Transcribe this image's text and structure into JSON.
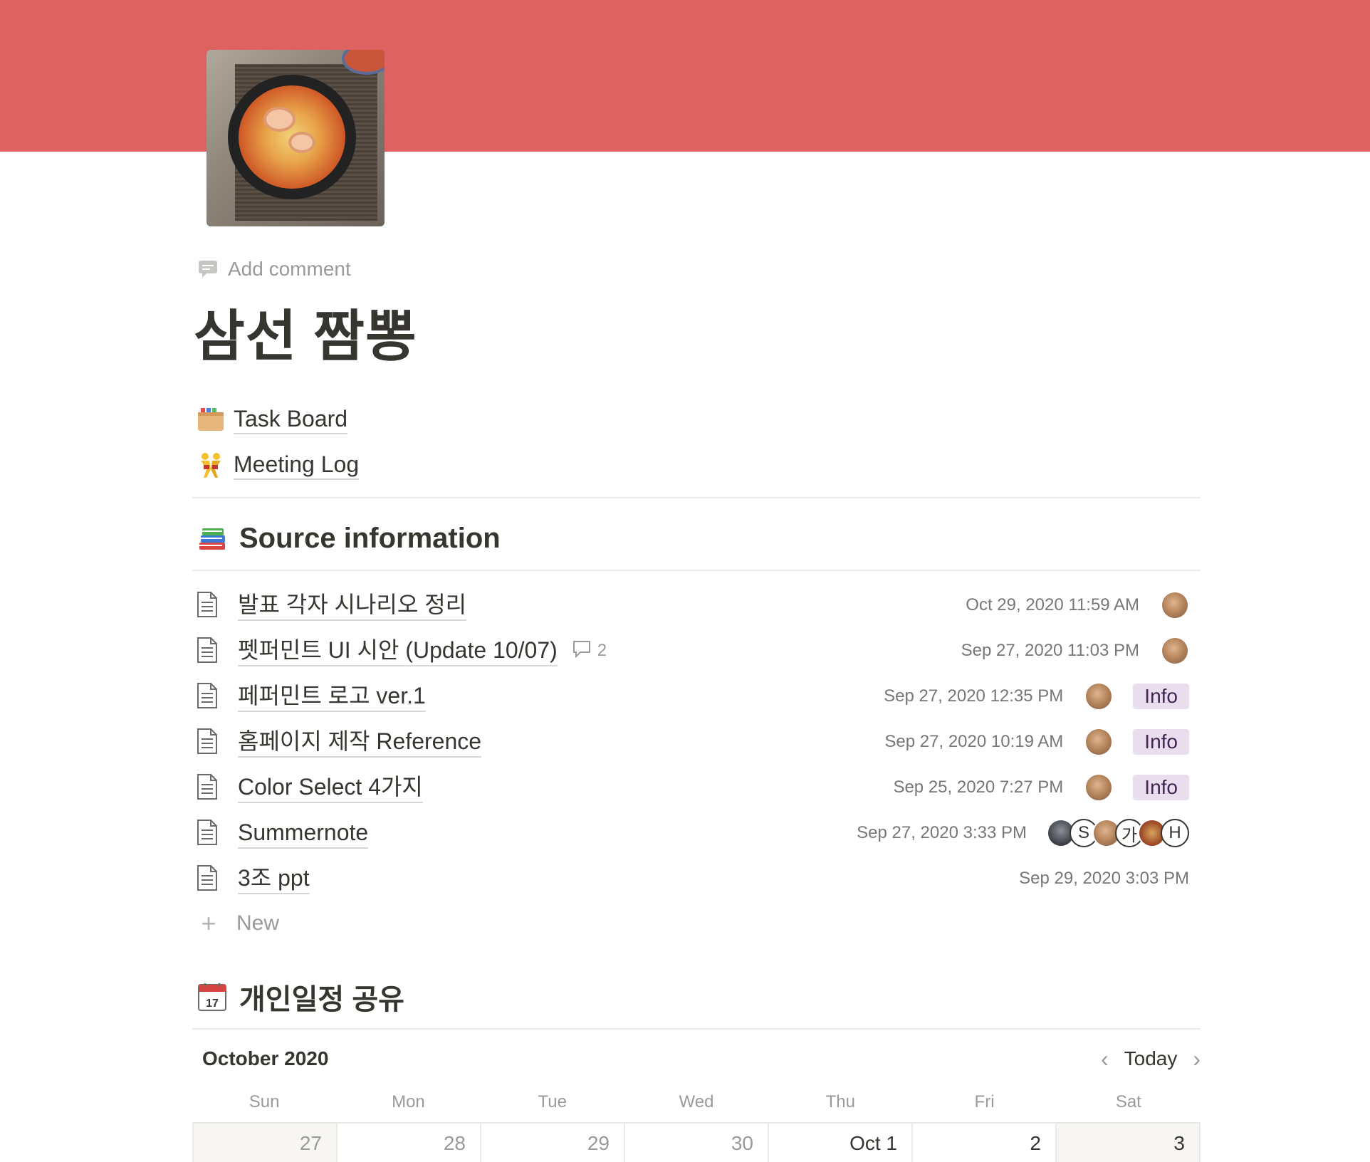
{
  "header": {
    "cover_color": "#de625f",
    "add_comment_label": "Add comment",
    "title": "삼선 짬뽕"
  },
  "links": [
    {
      "icon": "file-box-icon",
      "label": "Task Board"
    },
    {
      "icon": "wrestlers-icon",
      "label": "Meeting Log"
    }
  ],
  "source_section": {
    "icon": "books-icon",
    "heading": "Source  information",
    "rows": [
      {
        "title": "발표 각자 시나리오 정리",
        "date": "Oct 29, 2020 11:59 AM"
      },
      {
        "title": "펫퍼민트 UI 시안 (Update 10/07)",
        "comment_count": "2",
        "date": "Sep 27, 2020 11:03 PM"
      },
      {
        "title": "페퍼민트 로고 ver.1",
        "date": "Sep 27, 2020 12:35 PM",
        "tag": "Info"
      },
      {
        "title": "홈페이지 제작 Reference",
        "date": "Sep 27, 2020 10:19 AM",
        "tag": "Info"
      },
      {
        "title": "Color Select 4가지",
        "date": "Sep 25, 2020 7:27 PM",
        "tag": "Info"
      },
      {
        "title": "Summernote",
        "date": "Sep 27, 2020 3:33 PM",
        "avatar_letters": [
          "S",
          "가",
          "H"
        ]
      },
      {
        "title": "3조 ppt",
        "date": "Sep 29, 2020 3:03 PM"
      }
    ],
    "new_label": "New"
  },
  "calendar_section": {
    "icon": "calendar-icon",
    "heading": "개인일정 공유",
    "month_label": "October 2020",
    "today_label": "Today",
    "weekdays": [
      "Sun",
      "Mon",
      "Tue",
      "Wed",
      "Thu",
      "Fri",
      "Sat"
    ],
    "first_week": [
      "27",
      "28",
      "29",
      "30",
      "Oct 1",
      "2",
      "3"
    ]
  },
  "colors": {
    "text": "#37352f",
    "muted": "#9b9a97",
    "tag_bg": "#e8deee",
    "tag_text": "#412454"
  }
}
